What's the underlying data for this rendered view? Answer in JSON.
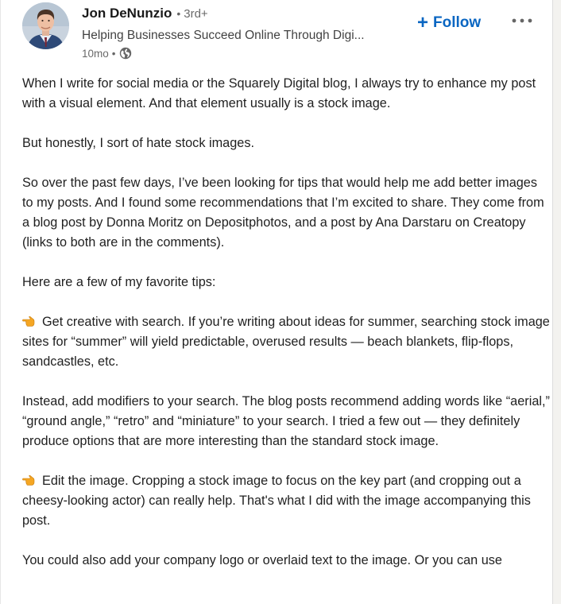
{
  "post": {
    "author": {
      "name": "Jon DeNunzio",
      "separator": "•",
      "degree": "3rd+",
      "headline": "Helping Businesses Succeed Online Through Digi...",
      "time": "10mo",
      "time_separator": "•",
      "visibility_icon": "globe-icon"
    },
    "follow_label": "Follow",
    "more_icon": "ellipsis-icon",
    "paragraphs": [
      "When I write for social media or the Squarely Digital blog, I always try to enhance my post with a visual element. And that element usually is a stock image.",
      "But honestly, I sort of hate stock images.",
      "So over the past few days, I’ve been looking for tips that would help me add better images to my posts. And I found some recommendations that I’m excited to share. They come from a blog post by Donna Moritz on Depositphotos, and a post by Ana Darstaru on Creatopy (links to both are in the comments).",
      "Here are a few of my favorite tips:",
      "Get creative with search. If you’re writing about ideas for summer, searching stock image sites for “summer” will yield predictable, overused results — beach blankets, flip-flops, sandcastles, etc.",
      "Instead, add modifiers to your search. The blog posts recommend adding words like “aerial,” “ground angle,” “retro” and “miniature” to your search. I tried a few out — they definitely produce options that are more interesting than the standard stock image.",
      "Edit the image. Cropping a stock image to focus on the key part (and cropping out a cheesy-looking actor) can really help. That's what I did with the image accompanying this post.",
      "You could also add your company logo or overlaid text to the image. Or you can use"
    ],
    "bullet_icon": "pointing-hand-icon",
    "colors": {
      "accent": "#0a66c2",
      "bullet": "#f5a623"
    }
  }
}
